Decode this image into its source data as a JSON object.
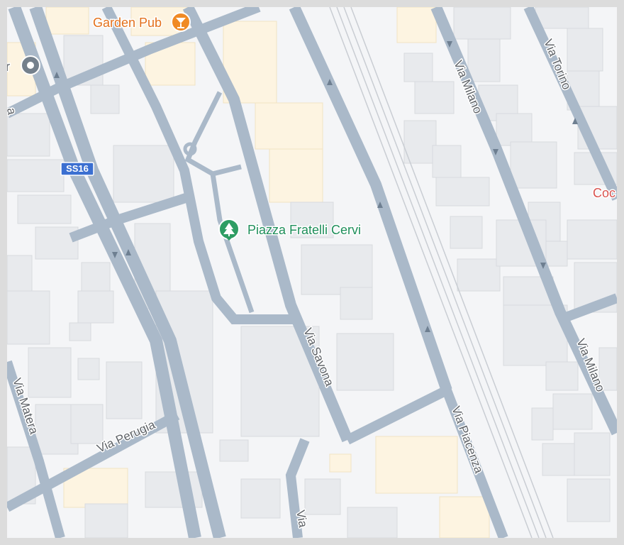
{
  "map": {
    "colors": {
      "road": "#aab9c9",
      "background": "#f4f5f7",
      "building": "#e8eaed",
      "building_highlight": "#fdf4e1",
      "park_label": "#1e8e5a",
      "pub_label": "#e3701b"
    },
    "streets": {
      "via_milano_upper": "Via Milano",
      "via_milano_lower": "Via Milano",
      "via_torino": "Via Torino",
      "via_savona": "Via Savona",
      "via_piacenza": "Via Piacenza",
      "via_perugia": "Via Perugia",
      "via_matera": "Via Matera",
      "via_partial_bottom": "Via",
      "partial_left_top": "a"
    },
    "shield": {
      "label": "SS16",
      "color": "#3b6fd1"
    },
    "pois": {
      "garden_pub": {
        "label": "Garden Pub",
        "icon": "cocktail-icon"
      },
      "piazza": {
        "label": "Piazza Fratelli Cervi",
        "icon": "tree-icon"
      },
      "partial_left": {
        "label": "ir",
        "icon": "place-pin-icon"
      },
      "partial_right": {
        "label": "Coc"
      }
    }
  }
}
